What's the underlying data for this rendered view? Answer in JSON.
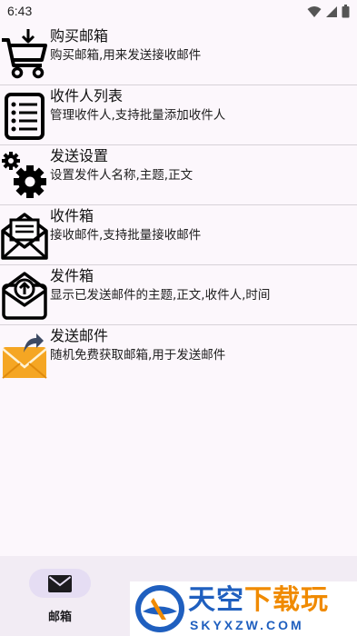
{
  "status_bar": {
    "time": "6:43",
    "icons": [
      "wifi-icon",
      "signal-icon",
      "battery-icon"
    ]
  },
  "menu": {
    "items": [
      {
        "title": "购买邮箱",
        "desc": "购买邮箱,用来发送接收邮件",
        "icon": "shopping-cart-icon"
      },
      {
        "title": "收件人列表",
        "desc": "管理收件人,支持批量添加收件人",
        "icon": "list-icon"
      },
      {
        "title": "发送设置",
        "desc": "设置发件人名称,主题,正文",
        "icon": "gears-icon"
      },
      {
        "title": "收件箱",
        "desc": "接收邮件,支持批量接收邮件",
        "icon": "inbox-envelope-icon"
      },
      {
        "title": "发件箱",
        "desc": "显示已发送邮件的主题,正文,收件人,时间",
        "icon": "outbox-envelope-icon"
      },
      {
        "title": "发送邮件",
        "desc": "随机免费获取邮箱,用于发送邮件",
        "icon": "send-mail-icon"
      }
    ]
  },
  "bottom_nav": {
    "active_tab": {
      "label": "邮箱",
      "icon": "mail-icon"
    }
  },
  "watermark": {
    "title_main": "天空",
    "title_accent": "下载玩",
    "url": "SKYXZW.COM"
  },
  "colors": {
    "background": "#fcf7fc",
    "nav_background": "#f2ecf4",
    "nav_pill": "#e5ddf3",
    "watermark_blue": "#1f5fbf",
    "watermark_orange": "#f08a00"
  }
}
